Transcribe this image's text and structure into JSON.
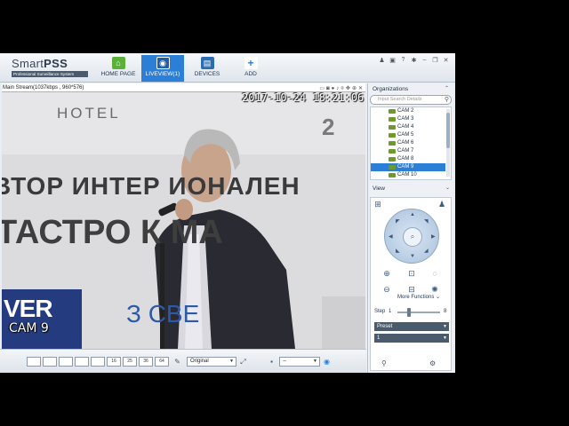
{
  "app": {
    "brand_name_light": "Smart",
    "brand_name_bold": "PSS",
    "brand_subtitle": "Professional Surveillance System"
  },
  "nav": {
    "tabs": [
      {
        "label": "HOME PAGE",
        "icon": "home-icon",
        "color": "#5bb03a"
      },
      {
        "label": "LIVEVIEW(1)",
        "icon": "camera-icon",
        "color": "#2b7fd6",
        "active": true
      },
      {
        "label": "DEVICES",
        "icon": "devices-icon",
        "color": "#2b6db0"
      },
      {
        "label": "ADD",
        "icon": "plus-icon",
        "color": "#2b7fd6"
      }
    ]
  },
  "window_controls": [
    "user-icon",
    "lock-icon",
    "help-icon",
    "settings-icon",
    "minimize-icon",
    "restore-icon",
    "close-icon"
  ],
  "video": {
    "stream_info": "Main Stream(1037kbps , 960*576)",
    "timestamp": "2017-10-24 18:21:06",
    "camera_osd": "CAM 9",
    "scene_text": {
      "hotel": "HOTEL",
      "number": "2",
      "line1": "ВТОР ИНТЕР   ИОНАЛЕН",
      "line2": "ТАСТРО    К МА",
      "line3": "З    СВЕ",
      "logo": "VER"
    }
  },
  "toolbar": {
    "layouts": [
      "1",
      "4",
      "6",
      "8",
      "9",
      "16",
      "25",
      "36",
      "64"
    ],
    "video_mode": "Original",
    "stream_select": "--"
  },
  "panel": {
    "organizations_title": "Organizations",
    "search_placeholder": "Input Search Details",
    "cameras": [
      "CAM 2",
      "CAM 3",
      "CAM 4",
      "CAM 5",
      "CAM 6",
      "CAM 7",
      "CAM 8",
      "CAM 9",
      "CAM 10"
    ],
    "selected_camera": "CAM 9",
    "view_title": "View",
    "more_functions": "More Functions",
    "step_label": "Step",
    "step_min": "1",
    "step_max": "8",
    "step_value": 0.25,
    "preset_label": "Preset",
    "preset_value": "1"
  },
  "colors": {
    "accent": "#2b7fd6",
    "panel_bg": "#edf1f5"
  }
}
